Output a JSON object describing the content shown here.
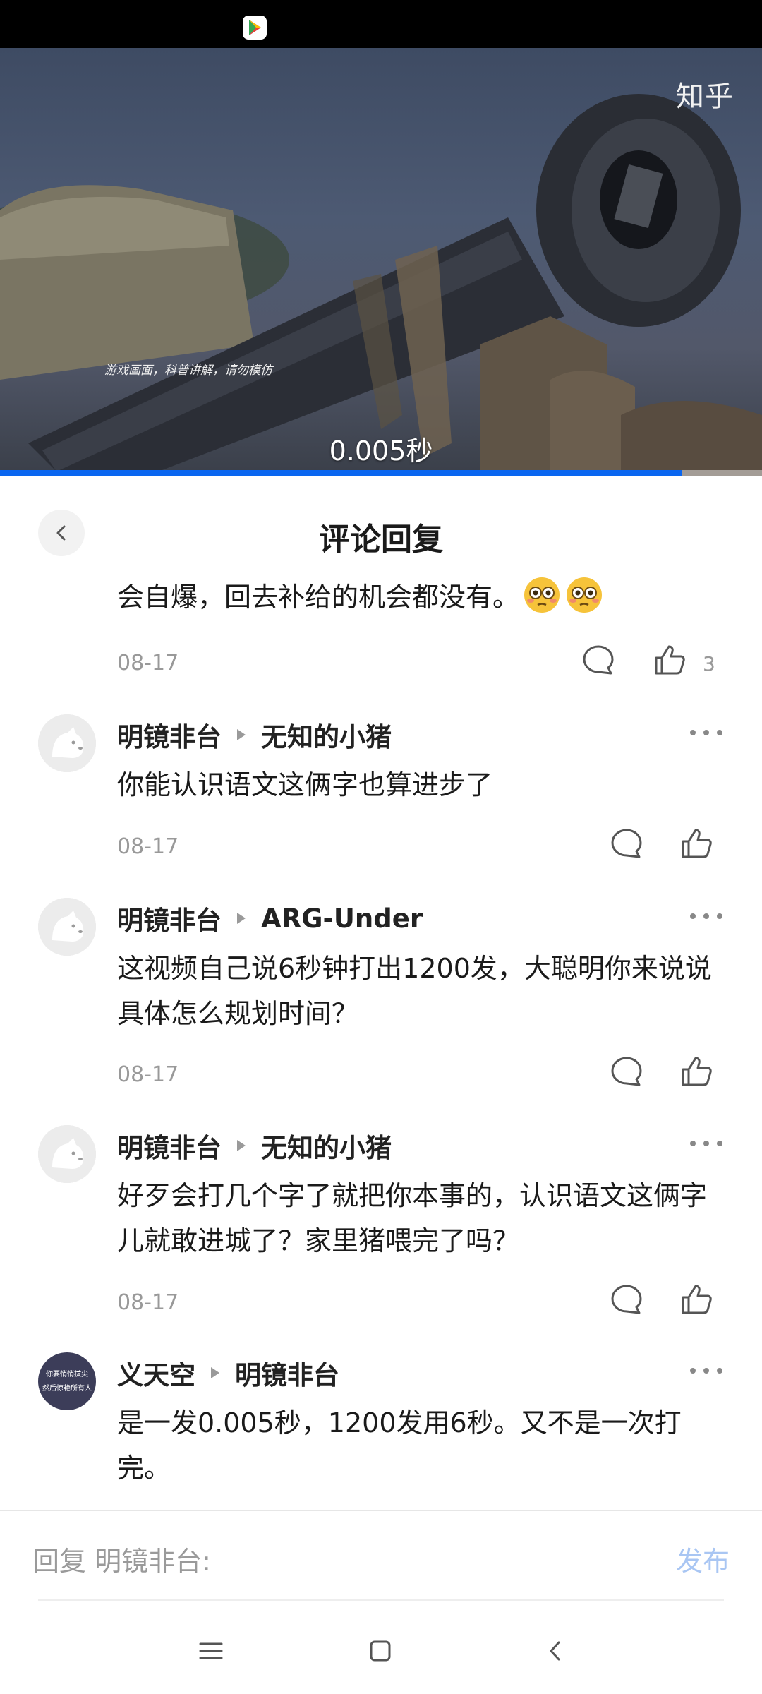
{
  "video": {
    "watermark": "知乎",
    "small_subtitle": "游戏画面，科普讲解，请勿模仿",
    "caption": "0.005秒",
    "progress_fraction": 0.895
  },
  "header": {
    "title": "评论回复"
  },
  "first_comment": {
    "text": "会自爆，回去补给的机会都没有。",
    "date": "08-17",
    "like_count": "3"
  },
  "comments": [
    {
      "author": "明镜非台",
      "reply_to": "无知的小猪",
      "text": "你能认识语文这俩字也算进步了",
      "date": "08-17"
    },
    {
      "author": "明镜非台",
      "reply_to": "ARG-Under",
      "text": "这视频自己说6秒钟打出1200发，大聪明你来说说具体怎么规划时间？",
      "date": "08-17"
    },
    {
      "author": "明镜非台",
      "reply_to": "无知的小猪",
      "text": "好歹会打几个字了就把你本事的，认识语文这俩字儿就敢进城了？家里猪喂完了吗？",
      "date": "08-17"
    },
    {
      "author": "义天空",
      "reply_to": "明镜非台",
      "text": "是一发0.005秒，1200发用6秒。又不是一次打完。",
      "avatar_text": [
        "你要悄悄拔尖",
        "然后惊艳所有人"
      ]
    }
  ],
  "reply_bar": {
    "placeholder": "回复 明镜非台:",
    "publish_label": "发布"
  },
  "colors": {
    "accent": "#0a66f0",
    "publish_disabled": "#a9c6f3",
    "muted": "#999999"
  },
  "icons": {
    "back": "chevron-left-icon",
    "comment": "comment-bubble-icon",
    "like": "thumbs-up-icon",
    "more": "more-dots-icon",
    "nav_menu": "menu-icon",
    "nav_home": "home-square-icon",
    "nav_back": "back-chevron-icon"
  }
}
